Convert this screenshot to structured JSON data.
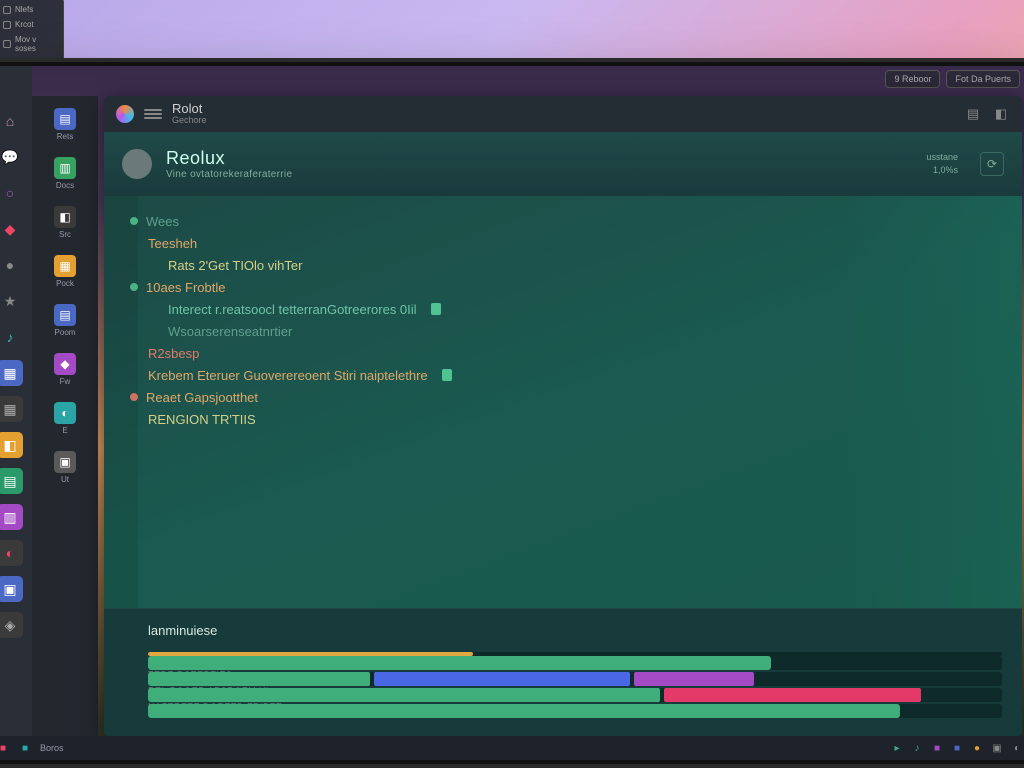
{
  "float_panel": {
    "items": [
      "Nlefs",
      "Krcot",
      "Mov v soses"
    ]
  },
  "topbar": {
    "chips": [
      "9 Reboor",
      "Fot Da Puerts"
    ]
  },
  "rail_icons": [
    {
      "name": "home-icon",
      "glyph": "⌂",
      "bg": "transparent",
      "fg": "#c9a"
    },
    {
      "name": "chat-icon",
      "glyph": "💬",
      "bg": "transparent",
      "fg": "#8c8"
    },
    {
      "name": "circle-icon",
      "glyph": "○",
      "bg": "transparent",
      "fg": "#a460c4"
    },
    {
      "name": "badge-icon",
      "glyph": "◆",
      "bg": "transparent",
      "fg": "#e46"
    },
    {
      "name": "bell-icon",
      "glyph": "●",
      "bg": "transparent",
      "fg": "#888"
    },
    {
      "name": "star-icon",
      "glyph": "★",
      "bg": "transparent",
      "fg": "#888"
    },
    {
      "name": "music-icon",
      "glyph": "♪",
      "bg": "transparent",
      "fg": "#4aa"
    },
    {
      "name": "app1-icon",
      "glyph": "▦",
      "bg": "#4a68c4",
      "fg": "#fff"
    },
    {
      "name": "app2-icon",
      "glyph": "▦",
      "bg": "#3a3a3a",
      "fg": "#aaa"
    },
    {
      "name": "app3-icon",
      "glyph": "◧",
      "bg": "#e4a030",
      "fg": "#fff"
    },
    {
      "name": "app4-icon",
      "glyph": "▤",
      "bg": "#2a9a6a",
      "fg": "#fff"
    },
    {
      "name": "app5-icon",
      "glyph": "▥",
      "bg": "#a44ac4",
      "fg": "#fff"
    },
    {
      "name": "app6-icon",
      "glyph": "◐",
      "bg": "#3a3a3a",
      "fg": "#e46"
    },
    {
      "name": "app7-icon",
      "glyph": "▣",
      "bg": "#4a68c4",
      "fg": "#fff"
    },
    {
      "name": "app8-icon",
      "glyph": "◈",
      "bg": "#3a3a3a",
      "fg": "#aaa"
    }
  ],
  "explorer": [
    {
      "name": "file-blue",
      "glyph": "▤",
      "bg": "#4a68c4",
      "label": "Rets"
    },
    {
      "name": "file-green",
      "glyph": "▥",
      "bg": "#38a060",
      "label": "Docs"
    },
    {
      "name": "file-dark",
      "glyph": "◧",
      "bg": "#3a3a3a",
      "label": "Src"
    },
    {
      "name": "file-orange",
      "glyph": "▦",
      "bg": "#e4a030",
      "label": "Pock"
    },
    {
      "name": "file-blue2",
      "glyph": "▤",
      "bg": "#4a68c4",
      "label": "Poom"
    },
    {
      "name": "file-purple",
      "glyph": "◆",
      "bg": "#a44ac4",
      "label": "Fw"
    },
    {
      "name": "file-teal",
      "glyph": "◐",
      "bg": "#2aa4a4",
      "label": "E"
    },
    {
      "name": "file-gray",
      "glyph": "▣",
      "bg": "#5a5a5a",
      "label": "Ut"
    }
  ],
  "titlebar": {
    "title": "Rolot",
    "subtitle": "Gechore"
  },
  "header": {
    "title": "Reolux",
    "subtitle": "Vine ovtatorekeraferaterrie",
    "stat1": "usstane",
    "stat2": "1,0%s"
  },
  "code_lines": [
    {
      "indent": 0,
      "dot": "#4fc490",
      "cls": "dim",
      "text": "Wees"
    },
    {
      "indent": 0,
      "dot": "",
      "cls": "kw",
      "text": "Teesheh"
    },
    {
      "indent": 1,
      "dot": "",
      "cls": "kw2",
      "text": "Rats 2'Get TIOlo vihTer"
    },
    {
      "indent": 0,
      "dot": "#4fc490",
      "cls": "kw",
      "text": "10aes Frobtle"
    },
    {
      "indent": 1,
      "dot": "",
      "cls": "str",
      "text": "Interect r.reatsoocl tetterranGotreerores 0Iil",
      "badge": true
    },
    {
      "indent": 1,
      "dot": "",
      "cls": "dim",
      "text": "Wsoarserenseatnrtier"
    },
    {
      "indent": 0,
      "dot": "",
      "cls": "red",
      "text": "R2sbesp"
    },
    {
      "indent": 0,
      "dot": "",
      "cls": "kw",
      "text": "Krebem Eteruer Guoverereoent Stiri naiptelethre",
      "badge": true
    },
    {
      "indent": 0,
      "dot": "#e47a6a",
      "cls": "kw",
      "text": "Reaet Gapsjootthet"
    },
    {
      "indent": 0,
      "dot": "",
      "cls": "kw2",
      "text": "RENGION TR'TIIS"
    }
  ],
  "bars": {
    "title": "lanminuiese",
    "rows": [
      {
        "label": "",
        "type": "thin",
        "segs": [
          {
            "w": 38,
            "c": "#e0a840"
          }
        ]
      },
      {
        "label": "",
        "type": "full",
        "segs": [
          {
            "w": 73,
            "c": "#3fae7a"
          }
        ]
      },
      {
        "label": "TERE RSEERTIES",
        "type": "full",
        "segs": [
          {
            "w": 26,
            "c": "#3fae7a"
          },
          {
            "w": 30,
            "c": "#4a68e4"
          },
          {
            "w": 14,
            "c": "#a44ac4"
          }
        ]
      },
      {
        "label": "REL ROGER APSRGEM VI",
        "type": "full",
        "segs": [
          {
            "w": 60,
            "c": "#3fae7a"
          },
          {
            "w": 30,
            "c": "#e43a6a"
          }
        ]
      },
      {
        "label": "NAFERFEE DORFED FRIBET",
        "type": "full",
        "segs": [
          {
            "w": 88,
            "c": "#3fae7a"
          }
        ]
      }
    ]
  },
  "taskbar": {
    "left": [
      {
        "name": "tb-red",
        "glyph": "■",
        "c": "#e46"
      },
      {
        "name": "tb-teal",
        "glyph": "■",
        "c": "#2aa"
      },
      {
        "name": "tb-text",
        "glyph": "Boros",
        "c": "#99a"
      }
    ],
    "right": [
      {
        "name": "tb-1",
        "glyph": "▸",
        "c": "#4a8"
      },
      {
        "name": "tb-2",
        "glyph": "♪",
        "c": "#4aa"
      },
      {
        "name": "tb-3",
        "glyph": "■",
        "c": "#a44ac4"
      },
      {
        "name": "tb-4",
        "glyph": "■",
        "c": "#4a68c4"
      },
      {
        "name": "tb-5",
        "glyph": "●",
        "c": "#e4a030"
      },
      {
        "name": "tb-6",
        "glyph": "▣",
        "c": "#888"
      },
      {
        "name": "tb-7",
        "glyph": "◐",
        "c": "#888"
      }
    ]
  }
}
